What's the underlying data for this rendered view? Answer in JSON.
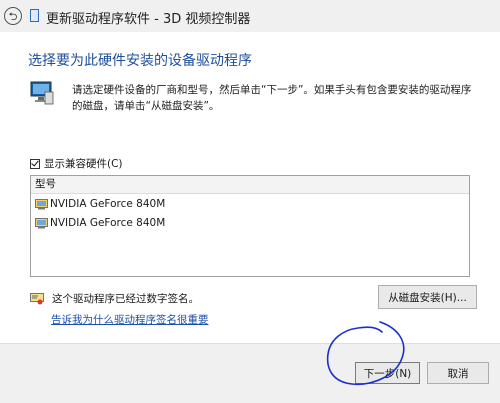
{
  "window": {
    "title": "更新驱动程序软件 - 3D 视频控制器",
    "back_glyph": "⮌"
  },
  "main": {
    "heading": "选择要为此硬件安装的设备驱动程序",
    "instruction": "请选定硬件设备的厂商和型号，然后单击“下一步”。如果手头有包含要安装的驱动程序的磁盘，请单击“从磁盘安装”。",
    "show_compatible_label": "显示兼容硬件(C)",
    "show_compatible_checked": true,
    "model_list": {
      "header": "型号",
      "items": [
        "NVIDIA GeForce 840M",
        "NVIDIA GeForce 840M"
      ]
    },
    "signed_text": "这个驱动程序已经过数字签名。",
    "have_disk_button": "从磁盘安装(H)...",
    "why_link": "告诉我为什么驱动程序签名很重要"
  },
  "footer": {
    "next_button": "下一步(N)",
    "cancel_button": "取消"
  },
  "colors": {
    "heading": "#1f4f9a",
    "link": "#1a4fb0",
    "annotation": "#1a2fd0"
  }
}
